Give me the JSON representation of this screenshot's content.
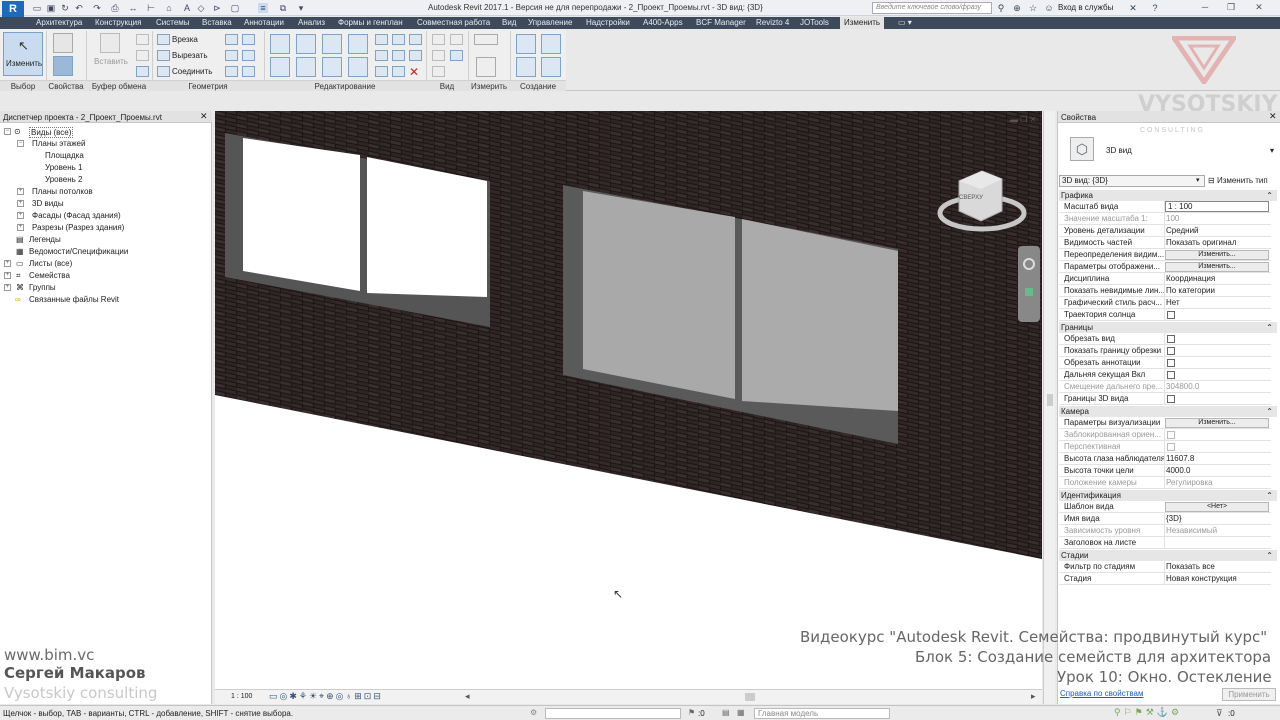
{
  "app_title": "Autodesk Revit 2017.1 - Версия не для перепродажи -    2_Проект_Проемы.rvt - 3D вид: {3D}",
  "search_placeholder": "Введите ключевое слово/фразу",
  "login_label": "Вход в службы",
  "tabs": [
    "Архитектура",
    "Конструкция",
    "Системы",
    "Вставка",
    "Аннотации",
    "Анализ",
    "Формы и генплан",
    "Совместная работа",
    "Вид",
    "Управление",
    "Надстройки",
    "A400-Apps",
    "BCF Manager",
    "Revizto 4",
    "JOTools",
    "Изменить"
  ],
  "ribbon": {
    "modify_label": "Изменить",
    "paste_label": "Вставить",
    "cope_label": "Врезка",
    "cut_label": "Вырезать",
    "join_label": "Соединить",
    "panels": [
      "Выбор",
      "Свойства",
      "Буфер обмена",
      "Геометрия",
      "Редактирование",
      "Вид",
      "Измерить",
      "Создание"
    ]
  },
  "project_browser": {
    "title": "Диспетчер проекта - 2_Проект_Проемы.rvt",
    "items": [
      "Виды (все)",
      "Планы этажей",
      "Площадка",
      "Уровень 1",
      "Уровень 2",
      "Планы потолков",
      "3D виды",
      "Фасады (Фасад здания)",
      "Разрезы (Разрез здания)",
      "Легенды",
      "Ведомости/Спецификации",
      "Листы (все)",
      "Семейства",
      "Группы",
      "Связанные файлы Revit"
    ]
  },
  "view": {
    "scale": "1 : 100",
    "viewcube_label": "СВЕРХУ"
  },
  "properties": {
    "title": "Свойства",
    "type_name": "3D вид",
    "selector": "3D вид: {3D}",
    "edit_type": "Изменить тип",
    "categories": [
      "Графика",
      "Границы",
      "Камера",
      "Идентификация",
      "Стадии"
    ],
    "graphics_rows": [
      {
        "name": "Масштаб вида",
        "value": "1 : 100"
      },
      {
        "name": "Значение масштаба    1:",
        "value": "100"
      },
      {
        "name": "Уровень детализации",
        "value": "Средний"
      },
      {
        "name": "Видимость частей",
        "value": "Показать оригинал"
      },
      {
        "name": "Переопределения видим...",
        "value": "Изменить..."
      },
      {
        "name": "Параметры отображени...",
        "value": "Изменить..."
      },
      {
        "name": "Дисциплина",
        "value": "Координация"
      },
      {
        "name": "Показать невидимые лин...",
        "value": "По категории"
      },
      {
        "name": "Графический стиль расч...",
        "value": "Нет"
      },
      {
        "name": "Траектория солнца",
        "value": ""
      }
    ],
    "extents_rows": [
      {
        "name": "Обрезать вид",
        "value": ""
      },
      {
        "name": "Показать границу обрезки",
        "value": ""
      },
      {
        "name": "Обрезать аннотации",
        "value": ""
      },
      {
        "name": "Дальняя секущая Вкл",
        "value": ""
      },
      {
        "name": "Смещение дальнего пре...",
        "value": "304800.0"
      },
      {
        "name": "Границы 3D вида",
        "value": ""
      }
    ],
    "camera_rows": [
      {
        "name": "Параметры визуализации",
        "value": "Изменить..."
      },
      {
        "name": "Заблокированная ориен...",
        "value": ""
      },
      {
        "name": "Перспективная",
        "value": ""
      },
      {
        "name": "Высота глаза наблюдателя",
        "value": "11607.8"
      },
      {
        "name": "Высота точки цели",
        "value": "4000.0"
      },
      {
        "name": "Положение камеры",
        "value": "Регулировка"
      }
    ],
    "identity_rows": [
      {
        "name": "Шаблон вида",
        "value": "<Нет>"
      },
      {
        "name": "Имя вида",
        "value": "{3D}"
      },
      {
        "name": "Зависимость уровня",
        "value": "Независимый"
      },
      {
        "name": "Заголовок на листе",
        "value": ""
      }
    ],
    "phasing_rows": [
      {
        "name": "Фильтр по стадиям",
        "value": "Показать все"
      },
      {
        "name": "Стадия",
        "value": "Новая конструкция"
      }
    ],
    "help_link": "Справка по свойствам",
    "apply_button": "Применить"
  },
  "overlay": {
    "site": "www.bim.vc",
    "author": "Сергей Макаров",
    "company": "Vysotskiy consulting",
    "course": "Видеокурс \"Autodesk Revit. Семейства: продвинутый курс\"",
    "block": "Блок 5: Создание семейств для архитектора",
    "lesson": "Урок 10: Окно. Остекление",
    "logo": "VYSOTSKIY",
    "logo_sub": "C O N S U L T I N G"
  },
  "status": {
    "hint": "Щелчок - выбор, TAB - варианты, CTRL - добавление, SHIFT - снятие выбора.",
    "count": ":0",
    "model": "Главная модель",
    "filter_count": ":0"
  }
}
